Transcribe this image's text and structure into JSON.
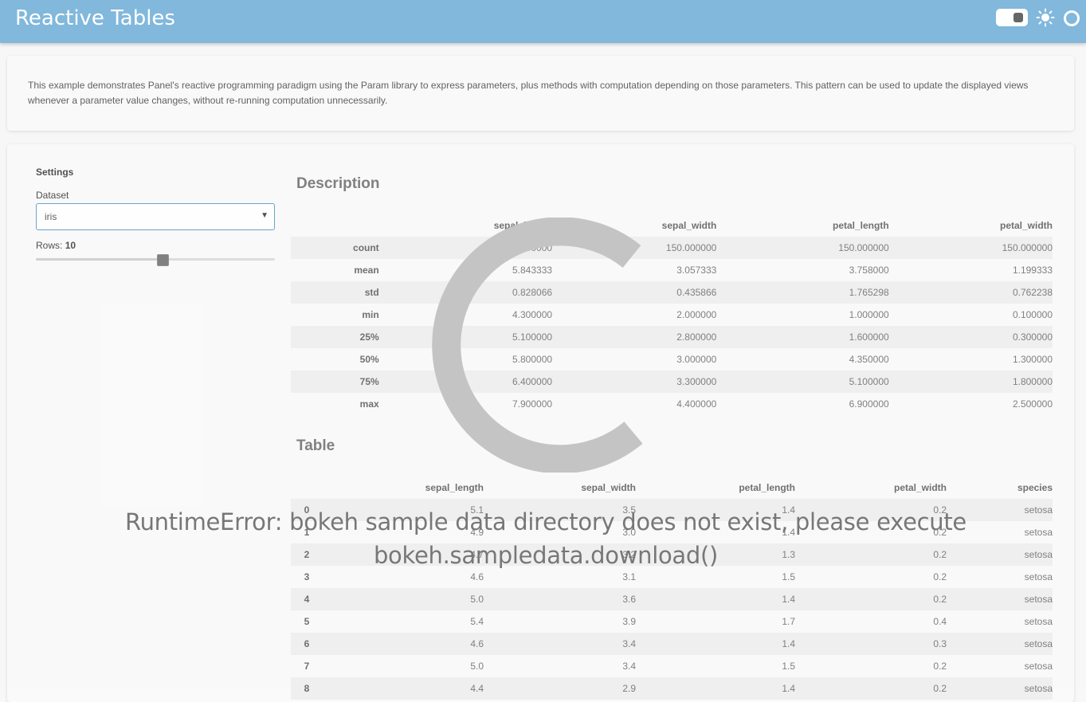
{
  "header": {
    "title": "Reactive Tables",
    "icons": [
      "theme-toggle",
      "sun-icon",
      "busy-indicator-icon"
    ]
  },
  "intro": {
    "text": "This example demonstrates Panel's reactive programming paradigm using the Param library to express parameters, plus methods with computation depending on those parameters. This pattern can be used to update the displayed views whenever a parameter value changes, without re-running computation unnecessarily."
  },
  "settings": {
    "title": "Settings",
    "dataset_label": "Dataset",
    "dataset_value": "iris",
    "rows_label": "Rows:",
    "rows_value": "10",
    "rows_slider_fraction": 0.53
  },
  "description": {
    "title": "Description",
    "columns": [
      "",
      "sepal_length",
      "sepal_width",
      "petal_length",
      "petal_width"
    ],
    "rows": [
      [
        "count",
        "150.000000",
        "150.000000",
        "150.000000",
        "150.000000"
      ],
      [
        "mean",
        "5.843333",
        "3.057333",
        "3.758000",
        "1.199333"
      ],
      [
        "std",
        "0.828066",
        "0.435866",
        "1.765298",
        "0.762238"
      ],
      [
        "min",
        "4.300000",
        "2.000000",
        "1.000000",
        "0.100000"
      ],
      [
        "25%",
        "5.100000",
        "2.800000",
        "1.600000",
        "0.300000"
      ],
      [
        "50%",
        "5.800000",
        "3.000000",
        "4.350000",
        "1.300000"
      ],
      [
        "75%",
        "6.400000",
        "3.300000",
        "5.100000",
        "1.800000"
      ],
      [
        "max",
        "7.900000",
        "4.400000",
        "6.900000",
        "2.500000"
      ]
    ]
  },
  "table": {
    "title": "Table",
    "columns": [
      "",
      "sepal_length",
      "sepal_width",
      "petal_length",
      "petal_width",
      "species"
    ],
    "rows": [
      [
        "0",
        "5.1",
        "3.5",
        "1.4",
        "0.2",
        "setosa"
      ],
      [
        "1",
        "4.9",
        "3.0",
        "1.4",
        "0.2",
        "setosa"
      ],
      [
        "2",
        "4.7",
        "3.2",
        "1.3",
        "0.2",
        "setosa"
      ],
      [
        "3",
        "4.6",
        "3.1",
        "1.5",
        "0.2",
        "setosa"
      ],
      [
        "4",
        "5.0",
        "3.6",
        "1.4",
        "0.2",
        "setosa"
      ],
      [
        "5",
        "5.4",
        "3.9",
        "1.7",
        "0.4",
        "setosa"
      ],
      [
        "6",
        "4.6",
        "3.4",
        "1.4",
        "0.3",
        "setosa"
      ],
      [
        "7",
        "5.0",
        "3.4",
        "1.5",
        "0.2",
        "setosa"
      ],
      [
        "8",
        "4.4",
        "2.9",
        "1.4",
        "0.2",
        "setosa"
      ]
    ]
  },
  "overlay": {
    "error_line1": "RuntimeError: bokeh sample data directory does not exist, please execute",
    "error_line2": "bokeh.sampledata.download()",
    "spinner_color": "#c4c4c4"
  },
  "colors": {
    "header_bg": "#81b8dc",
    "select_border": "#5da0c8"
  }
}
